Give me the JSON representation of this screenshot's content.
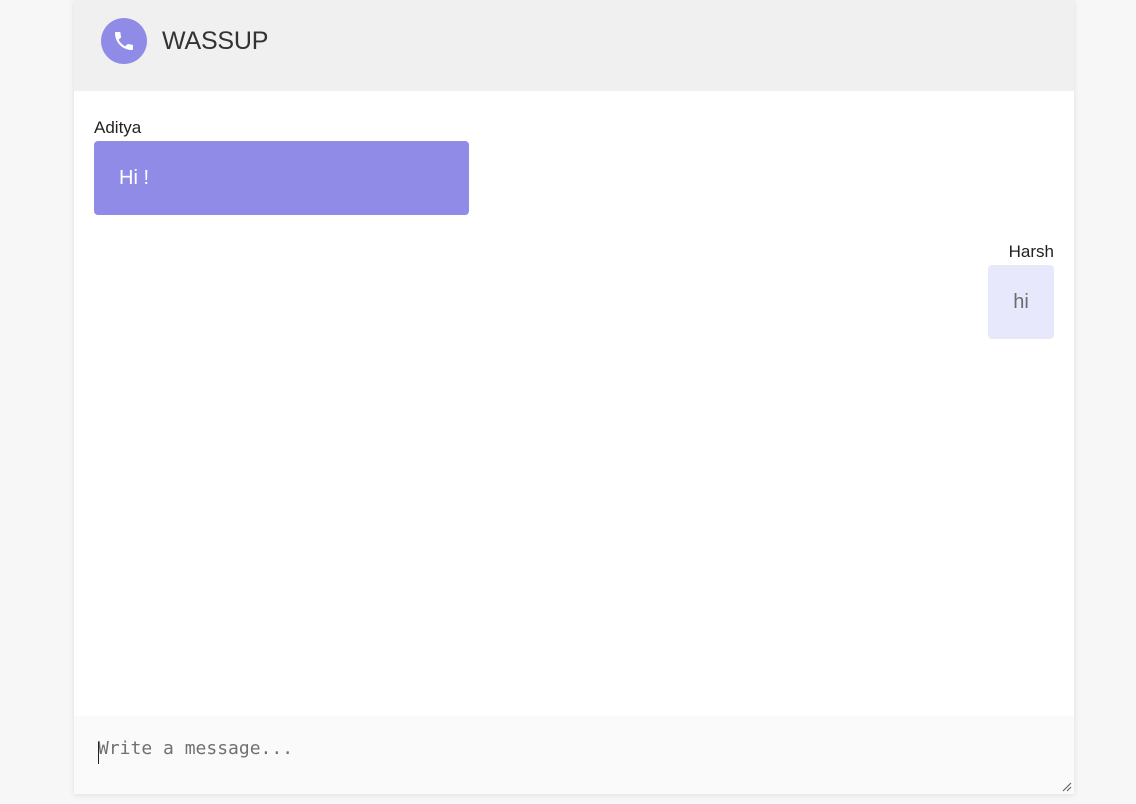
{
  "header": {
    "logo_icon": "phone-icon",
    "title": "WASSUP"
  },
  "messages": [
    {
      "sender": "Aditya",
      "text": "Hi !",
      "direction": "incoming"
    },
    {
      "sender": "Harsh",
      "text": "hi",
      "direction": "outgoing"
    }
  ],
  "composer": {
    "placeholder": "Write a message...",
    "value": ""
  },
  "colors": {
    "accent": "#918be8",
    "outgoing_bubble": "#e8e8fc",
    "header_bg": "#f0f0f0",
    "composer_bg": "#fafafa"
  }
}
